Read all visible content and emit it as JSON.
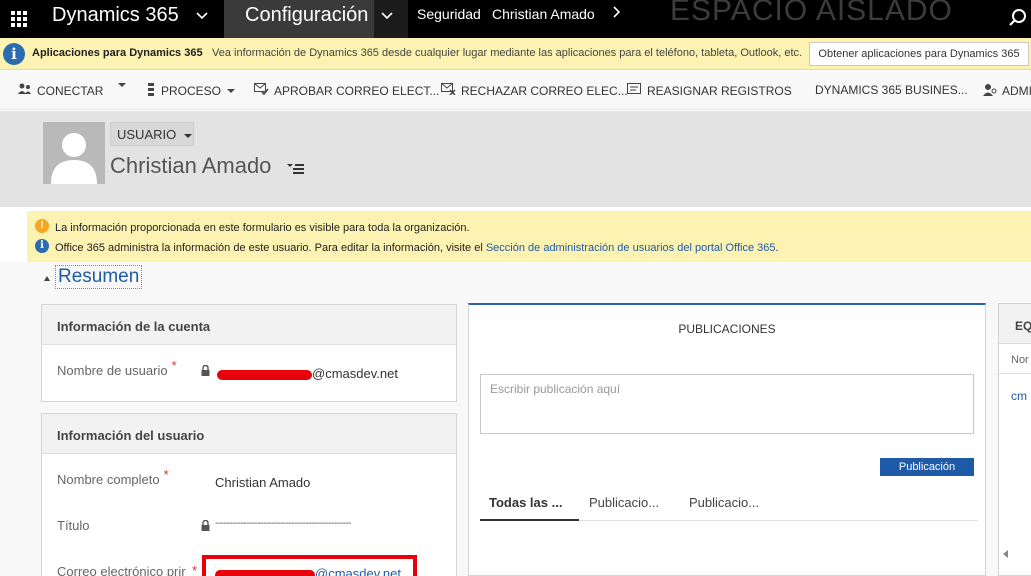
{
  "nav": {
    "app_title": "Dynamics 365",
    "area": "Configuración",
    "breadcrumb_section": "Seguridad",
    "breadcrumb_record": "Christian Amado",
    "sandbox_label": "ESPACIO AISLADO"
  },
  "apps_banner": {
    "title": "Aplicaciones para Dynamics 365",
    "text": "Vea información de Dynamics 365 desde cualquier lugar mediante las aplicaciones para el teléfono, tableta, Outlook, etc.",
    "button": "Obtener aplicaciones para Dynamics 365"
  },
  "commands": [
    {
      "label": "CONECTAR",
      "icon": "connect-icon"
    },
    {
      "label": "PROCESO",
      "icon": "process-icon"
    },
    {
      "label": "APROBAR CORREO ELECT...",
      "icon": "approve-email-icon"
    },
    {
      "label": "RECHAZAR CORREO ELEC...",
      "icon": "reject-email-icon"
    },
    {
      "label": "REASIGNAR REGISTROS",
      "icon": "reassign-icon"
    },
    {
      "label": "DYNAMICS 365 BUSINES...",
      "icon": ""
    },
    {
      "label": "ADMI",
      "icon": "admin-icon"
    }
  ],
  "header": {
    "entity": "USUARIO",
    "record_name": "Christian Amado"
  },
  "notifications": {
    "warning": "La información proporcionada en este formulario es visible para toda la organización.",
    "info": "Office 365 administra la información de este usuario. Para editar la información, visite el ",
    "info_link": "Sección de administración de usuarios del portal Office 365",
    "info_end": "."
  },
  "section": {
    "title": "Resumen"
  },
  "account_info": {
    "title": "Información de la cuenta",
    "username_label": "Nombre de usuario",
    "username_domain": "@cmasdev.net"
  },
  "user_info": {
    "title": "Información del usuario",
    "fullname_label": "Nombre completo",
    "fullname_value": "Christian Amado",
    "title_label": "Título",
    "title_value": "------------------------------------------------",
    "email_label": "Correo electrónico prir",
    "email_domain": "@cmasdev.net"
  },
  "posts": {
    "title": "PUBLICACIONES",
    "placeholder": "Escribir publicación aquí",
    "button": "Publicación",
    "tabs": [
      "Todas las ...",
      "Publicacio...",
      "Publicacio..."
    ]
  },
  "team_panel": {
    "title": "EQ",
    "column": "Nor",
    "row": "cm"
  },
  "colors": {
    "nav_bg": "#000000",
    "banner_bg": "#fcf2b2",
    "accent_blue": "#1e5aa8",
    "redaction": "#e8000b"
  }
}
